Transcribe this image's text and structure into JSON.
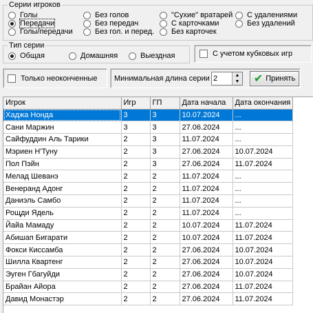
{
  "series_group": {
    "title": "Серии игроков",
    "options": [
      {
        "label": "Голы",
        "selected": false
      },
      {
        "label": "Передачи",
        "selected": true
      },
      {
        "label": "Голы/передачи",
        "selected": false
      },
      {
        "label": "Без голов",
        "selected": false
      },
      {
        "label": "Без передач",
        "selected": false
      },
      {
        "label": "Без гол. и перед.",
        "selected": false
      },
      {
        "label": "\"Сухие\" вратарей",
        "selected": false
      },
      {
        "label": "С карточками",
        "selected": false
      },
      {
        "label": "Без карточек",
        "selected": false
      },
      {
        "label": "С удалениями",
        "selected": false
      },
      {
        "label": "Без удалений",
        "selected": false
      }
    ]
  },
  "series_type": {
    "title": "Тип серии",
    "options": [
      {
        "label": "Общая",
        "selected": true
      },
      {
        "label": "Домашняя",
        "selected": false
      },
      {
        "label": "Выездная",
        "selected": false
      }
    ]
  },
  "cup_games": {
    "label": "С учетом кубковых игр",
    "checked": false
  },
  "unfinished_only": {
    "label": "Только неоконченные",
    "checked": false
  },
  "min_length": {
    "label": "Минимальная длина серии",
    "value": "2"
  },
  "accept_button": {
    "label": "Принять"
  },
  "table": {
    "columns": [
      "Игрок",
      "Игр",
      "ГП",
      "Дата начала",
      "Дата окончания"
    ],
    "selected_row": 0,
    "rows": [
      [
        "Хаджа Нонда",
        "3",
        "3",
        "10.07.2024",
        "..."
      ],
      [
        "Сани Маржин",
        "3",
        "3",
        "27.06.2024",
        "..."
      ],
      [
        "Сайфуддин Аль Тарики",
        "2",
        "3",
        "11.07.2024",
        "..."
      ],
      [
        "Мэриен Н'Туну",
        "2",
        "3",
        "27.06.2024",
        "10.07.2024"
      ],
      [
        "Пол Пэйн",
        "2",
        "3",
        "27.06.2024",
        "11.07.2024"
      ],
      [
        "Мелад Шеванэ",
        "2",
        "2",
        "11.07.2024",
        "..."
      ],
      [
        "Венеранд Адонг",
        "2",
        "2",
        "11.07.2024",
        "..."
      ],
      [
        "Даниэль Самбо",
        "2",
        "2",
        "11.07.2024",
        "..."
      ],
      [
        "Рощди Ядель",
        "2",
        "2",
        "11.07.2024",
        "..."
      ],
      [
        "Йайа Мамаду",
        "2",
        "2",
        "10.07.2024",
        "11.07.2024"
      ],
      [
        "Абишап Бигарати",
        "2",
        "2",
        "10.07.2024",
        "11.07.2024"
      ],
      [
        "Фокси Киссамба",
        "2",
        "2",
        "27.06.2024",
        "10.07.2024"
      ],
      [
        "Шилла Квартенг",
        "2",
        "2",
        "27.06.2024",
        "10.07.2024"
      ],
      [
        "Эугeн Гбагуйди",
        "2",
        "2",
        "27.06.2024",
        "10.07.2024"
      ],
      [
        "Брайан Айора",
        "2",
        "2",
        "27.06.2024",
        "11.07.2024"
      ],
      [
        "Давид Монастэр",
        "2",
        "2",
        "27.06.2024",
        "11.07.2024"
      ]
    ]
  }
}
